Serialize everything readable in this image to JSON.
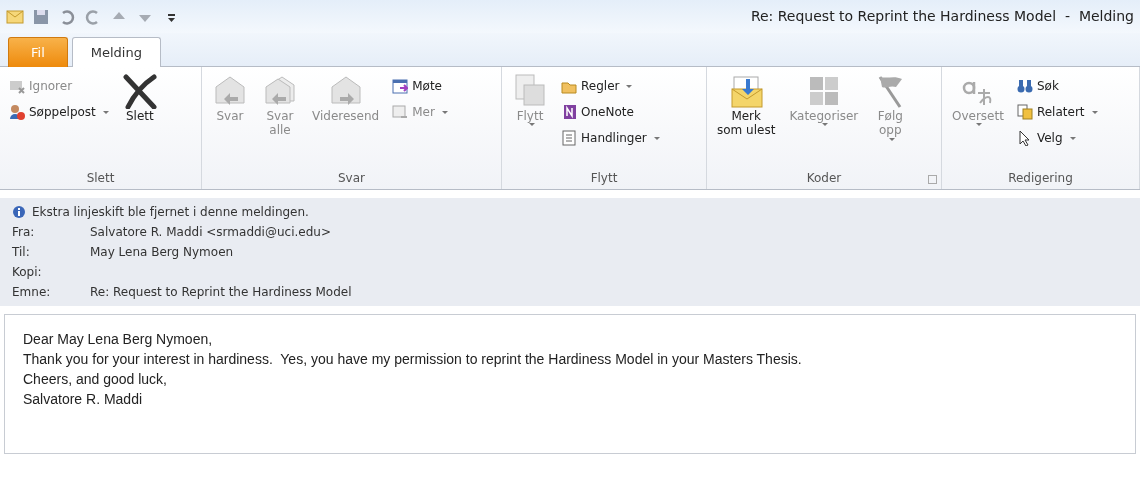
{
  "window": {
    "title": "Re: Request to Reprint the Hardiness Model  -  Melding"
  },
  "tabs": [
    {
      "label": "Fil",
      "kind": "file",
      "selected": false
    },
    {
      "label": "Melding",
      "kind": "normal",
      "selected": true
    }
  ],
  "ribbon": {
    "groups": [
      {
        "label": "Slett",
        "items": [
          {
            "label": "Ignorer",
            "kind": "small",
            "disabled": true,
            "dropdown": false
          },
          {
            "label": "Søppelpost",
            "kind": "small",
            "disabled": false,
            "dropdown": true
          },
          {
            "label": "Slett",
            "kind": "large",
            "disabled": false,
            "dropdown": false
          }
        ]
      },
      {
        "label": "Svar",
        "items": [
          {
            "label": "Svar",
            "kind": "large",
            "disabled": true,
            "dropdown": false
          },
          {
            "label": "Svar\nalle",
            "kind": "large",
            "disabled": true,
            "dropdown": false
          },
          {
            "label": "Videresend",
            "kind": "large",
            "disabled": true,
            "dropdown": false
          },
          {
            "label": "Møte",
            "kind": "small",
            "disabled": false,
            "dropdown": false
          },
          {
            "label": "Mer",
            "kind": "small",
            "disabled": true,
            "dropdown": true
          }
        ]
      },
      {
        "label": "Flytt",
        "items": [
          {
            "label": "Flytt",
            "kind": "large",
            "disabled": true,
            "dropdown": true
          },
          {
            "label": "Regler",
            "kind": "small",
            "disabled": false,
            "dropdown": true
          },
          {
            "label": "OneNote",
            "kind": "small",
            "disabled": false,
            "dropdown": false
          },
          {
            "label": "Handlinger",
            "kind": "small",
            "disabled": false,
            "dropdown": true
          }
        ]
      },
      {
        "label": "Koder",
        "launcher": true,
        "items": [
          {
            "label": "Merk\nsom ulest",
            "kind": "large",
            "disabled": false,
            "dropdown": false
          },
          {
            "label": "Kategoriser",
            "kind": "large",
            "disabled": true,
            "dropdown": true
          },
          {
            "label": "Følg\nopp",
            "kind": "large",
            "disabled": true,
            "dropdown": true
          }
        ]
      },
      {
        "label": "Redigering",
        "items": [
          {
            "label": "Oversett",
            "kind": "large",
            "disabled": true,
            "dropdown": true
          },
          {
            "label": "Søk",
            "kind": "small",
            "disabled": false,
            "dropdown": false
          },
          {
            "label": "Relatert",
            "kind": "small",
            "disabled": false,
            "dropdown": true
          },
          {
            "label": "Velg",
            "kind": "small",
            "disabled": false,
            "dropdown": true
          }
        ]
      }
    ]
  },
  "header": {
    "info": "Ekstra linjeskift ble fjernet i denne meldingen.",
    "fields": [
      {
        "label": "Fra:",
        "value": "Salvatore R. Maddi <srmaddi@uci.edu>"
      },
      {
        "label": "Til:",
        "value": "May Lena Berg Nymoen"
      },
      {
        "label": "Kopi:"
      },
      {
        "label": "Emne:",
        "value": "Re: Request to Reprint the Hardiness Model"
      }
    ]
  },
  "body": {
    "lines": [
      "Dear May Lena Berg Nymoen,",
      "Thank you for your interest in hardiness.  Yes, you have my permission to reprint the Hardiness Model in your Masters Thesis.",
      "Cheers, and good luck,",
      "Salvatore R. Maddi"
    ]
  }
}
